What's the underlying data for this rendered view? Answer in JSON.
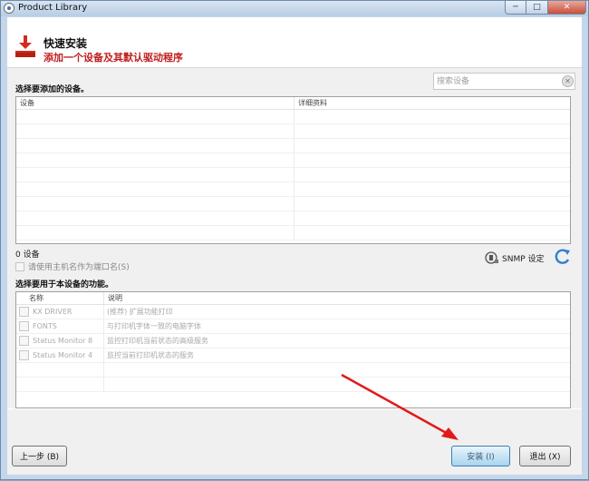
{
  "window": {
    "title": "Product Library",
    "controls": {
      "minimize": "─",
      "maximize": "□",
      "close": "✕"
    }
  },
  "header": {
    "title": "快速安装",
    "subtitle": "添加一个设备及其默认驱动程序",
    "icon": "download-tray-icon",
    "subtitle_color": "#c02020",
    "icon_color": "#d42b1e"
  },
  "devices": {
    "section_label": "选择要添加的设备。",
    "search": {
      "placeholder": "搜索设备",
      "value": ""
    },
    "columns": [
      "设备",
      "详细资料"
    ],
    "rows": [],
    "count_text": "0 设备",
    "use_hostname_label": "请使用主机名作为端口名(S)",
    "use_hostname_checked": false,
    "snmp_label": "SNMP 设定"
  },
  "features": {
    "section_label": "选择要用于本设备的功能。",
    "columns": [
      "名称",
      "说明"
    ],
    "rows": [
      {
        "name": "KX DRIVER",
        "desc": "(推荐) 扩展功能打印",
        "checked": false
      },
      {
        "name": "FONTS",
        "desc": "与打印机字体一致的电脑字体",
        "checked": false
      },
      {
        "name": "Status Monitor 8",
        "desc": "监控打印机当前状态的高级服务",
        "checked": false
      },
      {
        "name": "Status Monitor 4",
        "desc": "监控当前打印机状态的服务",
        "checked": false
      }
    ]
  },
  "buttons": {
    "back": "上一步 (B)",
    "install": "安装 (I)",
    "exit": "退出 (X)"
  },
  "annotation": {
    "arrow_color": "#e01a1a"
  }
}
